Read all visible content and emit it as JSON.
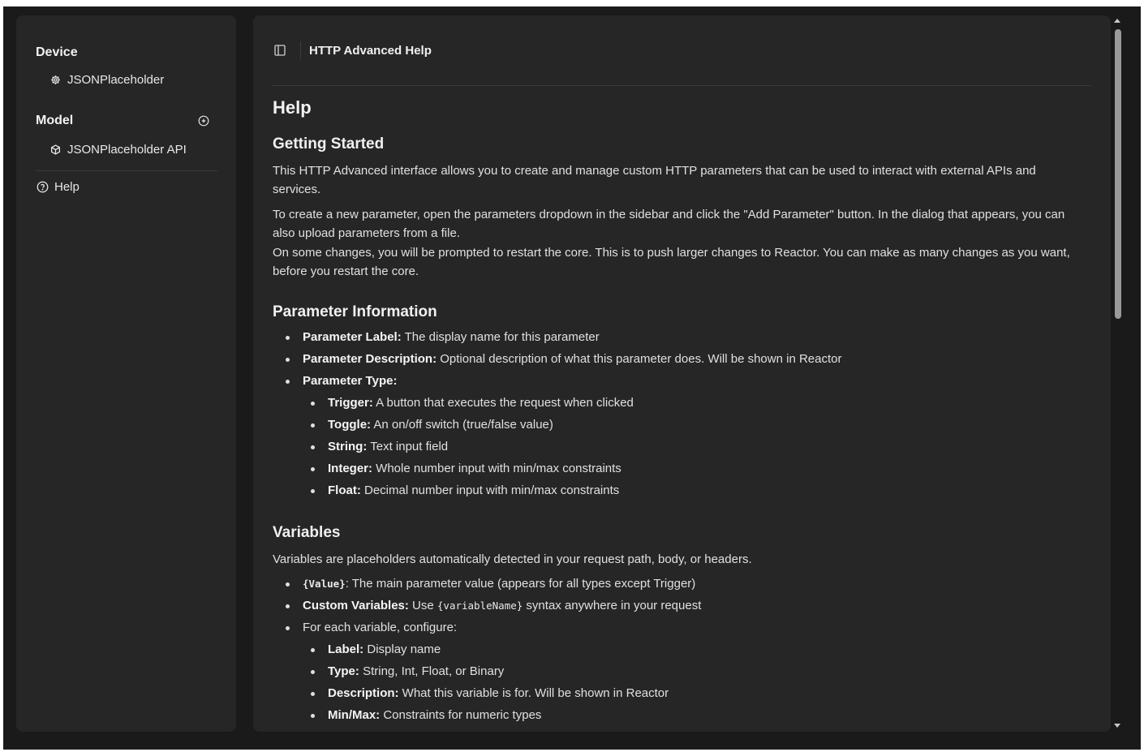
{
  "sidebar": {
    "device_title": "Device",
    "device_item": "JSONPlaceholder",
    "model_title": "Model",
    "model_item": "JSONPlaceholder API",
    "help_label": "Help"
  },
  "header": {
    "title": "HTTP Advanced Help"
  },
  "content": {
    "h1": "Help",
    "getting_started": {
      "title": "Getting Started",
      "p1": "This HTTP Advanced interface allows you to create and manage custom HTTP parameters that can be used to interact with external APIs and services.",
      "p2": "To create a new parameter, open the parameters dropdown in the sidebar and click the \"Add Parameter\" button. In the dialog that appears, you can also upload parameters from a file.",
      "p3": "On some changes, you will be prompted to restart the core. This is to push larger changes to Reactor. You can make as many changes as you want, before you restart the core."
    },
    "param_info": {
      "title": "Parameter Information",
      "items": [
        {
          "label": "Parameter Label:",
          "text": " The display name for this parameter"
        },
        {
          "label": "Parameter Description:",
          "text": " Optional description of what this parameter does. Will be shown in Reactor"
        },
        {
          "label": "Parameter Type:",
          "text": ""
        }
      ],
      "types": [
        {
          "label": "Trigger:",
          "text": " A button that executes the request when clicked"
        },
        {
          "label": "Toggle:",
          "text": " An on/off switch (true/false value)"
        },
        {
          "label": "String:",
          "text": " Text input field"
        },
        {
          "label": "Integer:",
          "text": " Whole number input with min/max constraints"
        },
        {
          "label": "Float:",
          "text": " Decimal number input with min/max constraints"
        }
      ]
    },
    "variables": {
      "title": "Variables",
      "intro": "Variables are placeholders automatically detected in your request path, body, or headers.",
      "value_code": "{Value}",
      "value_text": ": The main parameter value (appears for all types except Trigger)",
      "custom_label": "Custom Variables:",
      "custom_text_before": " Use ",
      "custom_code": "{variableName}",
      "custom_text_after": " syntax anywhere in your request",
      "configure_text": "For each variable, configure:",
      "config_items": [
        {
          "label": "Label:",
          "text": " Display name"
        },
        {
          "label": "Type:",
          "text": " String, Int, Float, or Binary"
        },
        {
          "label": "Description:",
          "text": " What this variable is for. Will be shown in Reactor"
        },
        {
          "label": "Min/Max:",
          "text": " Constraints for numeric types"
        }
      ]
    }
  }
}
